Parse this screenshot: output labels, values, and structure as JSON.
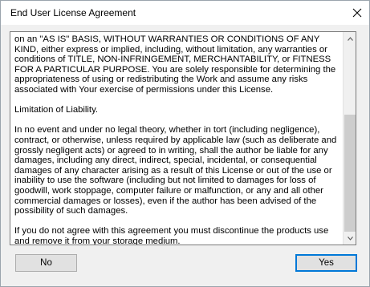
{
  "window": {
    "title": "End User License Agreement"
  },
  "license": {
    "paragraphs": [
      "on an \"AS IS\" BASIS, WITHOUT WARRANTIES OR CONDITIONS OF ANY KIND, either express or implied, including, without limitation, any warranties or conditions of TITLE, NON-INFRINGEMENT, MERCHANTABILITY, or FITNESS FOR A PARTICULAR PURPOSE. You are solely responsible for determining the appropriateness of using or redistributing the Work and assume any risks associated with Your exercise of permissions under this License.",
      "Limitation of Liability.",
      "In no event and under no legal theory, whether in tort (including negligence), contract, or otherwise, unless required by applicable law (such as deliberate and grossly negligent acts) or agreed to in writing, shall the author be liable for any damages, including any direct, indirect, special, incidental, or consequential damages of any character arising as a result of this License or out of the use or inability to use the software (including but not limited to damages for loss of goodwill, work stoppage, computer failure or malfunction, or any and all other commercial damages or losses), even if the author has been advised of the possibility of such damages.",
      "If you do not agree with this agreement you must discontinue the products use and remove it from your storage medium."
    ]
  },
  "buttons": {
    "no_label": "No",
    "yes_label": "Yes"
  },
  "icons": {
    "close": "close-icon",
    "scroll_up": "chevron-up-icon",
    "scroll_down": "chevron-down-icon"
  },
  "colors": {
    "default_button_border": "#0078d7",
    "scroll_thumb": "#cdcdcd"
  }
}
